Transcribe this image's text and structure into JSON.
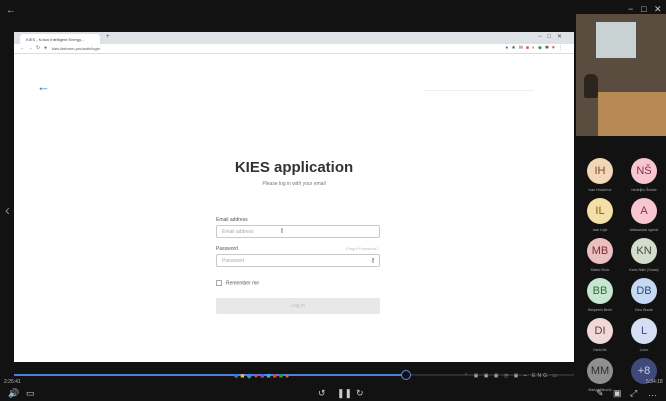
{
  "player": {
    "back_icon": "arrow-left-icon",
    "window_controls": [
      "−",
      "□",
      "✕"
    ],
    "current_time": "2:25:41",
    "total_time": "5:34:18",
    "progress_fraction": 0.7
  },
  "browser": {
    "tab_title": "KIES - Kotun Intelligent Energy...",
    "url": "kies.kiebrom.pro/auth/login",
    "window_controls": [
      "−",
      "□",
      "✕"
    ]
  },
  "login": {
    "title": "KIES application",
    "subtitle": "Please log in with your email",
    "email_label": "Email address",
    "email_placeholder": "Email address",
    "password_label": "Password",
    "password_aside": "Forgot Password?",
    "password_placeholder": "Password",
    "remember_label": "Remember me",
    "button_label": "Log in"
  },
  "participants": [
    {
      "initials": "IH",
      "name": "Ivan Hrvačević",
      "bg": "#f2d6b8",
      "fg": "#7a4a25"
    },
    {
      "initials": "NŠ",
      "name": "Nedeljko Šuhaić",
      "bg": "#f7c6cf",
      "fg": "#8a2d42"
    },
    {
      "initials": "IL",
      "name": "Ivan Lujić",
      "bg": "#f4e0a6",
      "fg": "#7a5d12"
    },
    {
      "initials": "A",
      "name": "Aleksandar ugrinić",
      "bg": "#f7c6cf",
      "fg": "#8a2d42"
    },
    {
      "initials": "MB",
      "name": "Marko Boric",
      "bg": "#e9bfbf",
      "fg": "#7a2d2d"
    },
    {
      "initials": "KN",
      "name": "Karlo Nikić (Guest)",
      "bg": "#d3dccd",
      "fg": "#3d4a36"
    },
    {
      "initials": "BB",
      "name": "Benjamin Berin",
      "bg": "#c8e6cf",
      "fg": "#2f6a3d"
    },
    {
      "initials": "DB",
      "name": "Dino Bucak",
      "bg": "#c7d8f2",
      "fg": "#2c4a7a"
    },
    {
      "initials": "DI",
      "name": "Dario Ilić",
      "bg": "#f2d9d9",
      "fg": "#6a3a3a"
    },
    {
      "initials": "L",
      "name": "Lovro",
      "bg": "#d6def5",
      "fg": "#3a4a8a"
    },
    {
      "initials": "MM",
      "name": "Mario Milinović",
      "bg": "#8f8f8f",
      "fg": "#2f2f2f"
    },
    {
      "initials": "+8",
      "name": "",
      "bg": "#3d4a7a",
      "fg": "#c9d2f2"
    }
  ],
  "bottom_controls": {
    "left": [
      "volume-icon",
      "subtitles-icon"
    ],
    "center": [
      "rewind-icon",
      "pause-icon",
      "forward-icon"
    ],
    "right": [
      "pen-icon",
      "pip-icon",
      "fullscreen-icon",
      "more-icon"
    ]
  }
}
